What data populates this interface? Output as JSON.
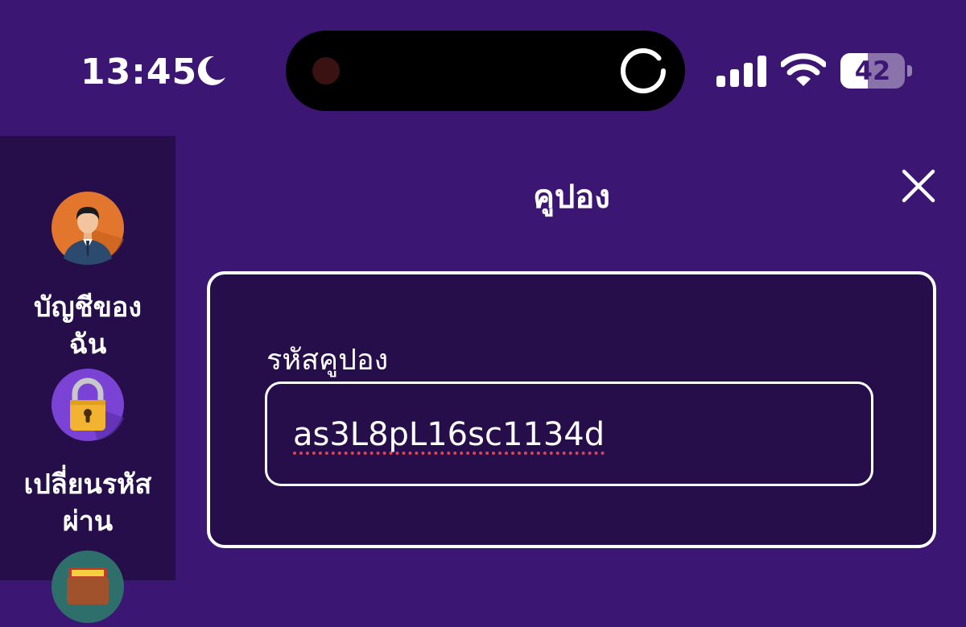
{
  "status_bar": {
    "time": "13:45",
    "focus_icon": "moon-icon",
    "battery_level": "42",
    "battery_fraction": 0.42
  },
  "sidebar": {
    "items": [
      {
        "label": "บัญชีของฉัน",
        "icon": "account-avatar-icon"
      },
      {
        "label": "เปลี่ยนรหัสผ่าน",
        "icon": "padlock-icon"
      },
      {
        "label": "",
        "icon": "wallet-icon"
      }
    ]
  },
  "dialog": {
    "title": "คูปอง",
    "close_icon": "close-icon",
    "field_label": "รหัสคูปอง",
    "field_value": "as3L8pL16sc1134d"
  },
  "colors": {
    "background": "#3c1673",
    "panel": "#260e4b",
    "spellcheck_underline": "#d8465a"
  }
}
